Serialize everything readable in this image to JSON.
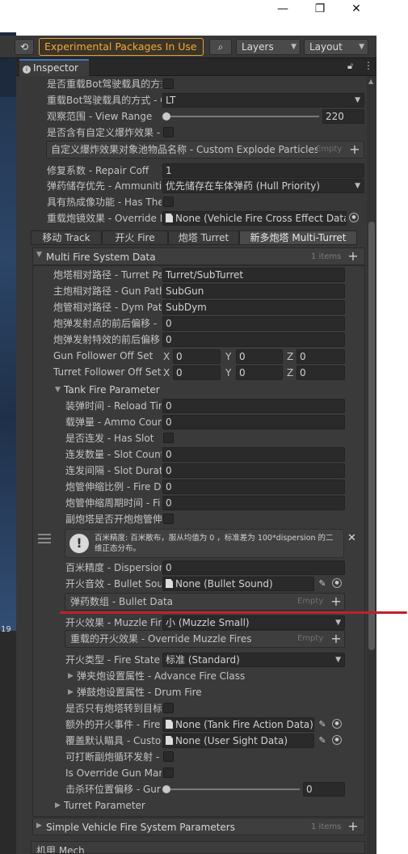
{
  "window": {
    "minimize": "—",
    "restore": "❐",
    "close": "✕"
  },
  "toolbar": {
    "history_icon": "history-icon",
    "packages_label": "Experimental Packages In Use ▼",
    "search_icon": "search-icon",
    "layers_label": "Layers",
    "layout_label": "Layout"
  },
  "left_strip": {
    "number": "19"
  },
  "tab": {
    "label": "Inspector"
  },
  "props_top": [
    {
      "label": "是否重载Bot驾驶载具的方式"
    },
    {
      "label": "重载Bot驾驶载具的方式 - C",
      "value": "LT"
    },
    {
      "label": "观察范围 - View Range",
      "value": "220"
    },
    {
      "label": "是否含有自定义爆炸效果 -"
    },
    {
      "label": "自定义爆炸效果对象池物品名称 - Custom Explode Particles",
      "tag": "Empty"
    },
    {
      "label": "修复系数 - Repair Coff",
      "value": "1"
    },
    {
      "label": "弹药储存优先 - Ammunitio",
      "value": "优先储存在车体弹药 (Hull Priority)"
    },
    {
      "label": "具有热成像功能 - Has The"
    },
    {
      "label": "重载炮镜效果 - Override F",
      "value": "None (Vehicle Fire Cross Effect Data)"
    }
  ],
  "subtabs": [
    "移动 Track",
    "开火 Fire",
    "炮塔 Turret",
    "新多炮塔 Multi-Turret"
  ],
  "multi_fire": {
    "title": "Multi Fire System Data",
    "count": "1 items",
    "rows": [
      {
        "label": "炮塔相对路径 - Turret Pa",
        "value": "Turret/SubTurret"
      },
      {
        "label": "主炮相对路径 - Gun Path",
        "value": "SubGun"
      },
      {
        "label": "炮管相对路径 - Dym Pat",
        "value": "SubDym"
      },
      {
        "label": "炮弹发射点的前后偏移 -",
        "value": "0"
      },
      {
        "label": "炮弹发射特效的前后偏移",
        "value": "0"
      }
    ],
    "gun_follower": {
      "label": "Gun Follower Off Set",
      "x": "0",
      "y": "0",
      "z": "0"
    },
    "turret_follower": {
      "label": "Turret Follower Off Set",
      "x": "0",
      "y": "0",
      "z": "0"
    },
    "axis": {
      "x": "X",
      "y": "Y",
      "z": "Z"
    }
  },
  "tank_fire": {
    "title": "Tank Fire Parameter",
    "rows": [
      {
        "label": "装弹时间 - Reload Tir",
        "value": "0"
      },
      {
        "label": "载弹量 - Ammo Coun",
        "value": "0"
      },
      {
        "label": "是否连发 - Has Slot"
      },
      {
        "label": "连发数量 - Slot Count",
        "value": "0"
      },
      {
        "label": "连发间隔 - Slot Durat",
        "value": "0"
      },
      {
        "label": "炮管伸缩比例 - Fire D",
        "value": "0"
      },
      {
        "label": "炮管伸缩周期时间 - Fi",
        "value": "0"
      },
      {
        "label": "副炮塔是否开炮炮管伸"
      }
    ],
    "help_icon": "!",
    "help_text": "百米精度: 百米散布，服从均值为 0 ，标准差为 100*dispersion 的二维正态分布。",
    "dispersion": {
      "label": "百米精度 - Dispersion",
      "value": "0"
    },
    "bullet_sound": {
      "label": "开火音效 - Bullet Sou",
      "value": "None (Bullet Sound)"
    },
    "bullet_data": {
      "label": "弹药数组 - Bullet Data",
      "tag": "Empty"
    },
    "muzzle": {
      "label": "开火效果 - Muzzle Fir",
      "value": "小 (Muzzle Small)"
    },
    "override_muzzle": {
      "label": "重载的开火效果 - Override Muzzle Fires",
      "tag": "Empty"
    },
    "fire_state": {
      "label": "开火类型 - Fire State",
      "value": "标准 (Standard)"
    },
    "advance_fire": "弹夹炮设置属性 - Advance Fire Class",
    "drum_fire": "弹鼓炮设置属性 - Drum Fire",
    "only_turn": {
      "label": "是否只有炮塔转到目标"
    },
    "extra_event": {
      "label": "额外的开火事件 - Fire",
      "value": "None (Tank Fire Action Data)"
    },
    "override_sight": {
      "label": "覆盖默认瞄具 - Custo",
      "value": "None (User Sight Data)"
    },
    "interrupt": {
      "label": "可打断副炮循环发射 -"
    },
    "override_gun_mark": {
      "label": "Is Override Gun Mark"
    },
    "ring_offset": {
      "label": "击杀环位置偏移 - Gur",
      "value": "0"
    }
  },
  "turret_param": "Turret Parameter",
  "simple_fire": {
    "title": "Simple Vehicle Fire System Parameters",
    "count": "1 items"
  },
  "next_section": "机甲 Mech",
  "colors": {
    "accent_orange": "#f2a93b",
    "annotation_red": "#c0202a",
    "tab_blue": "#3a79bb"
  }
}
